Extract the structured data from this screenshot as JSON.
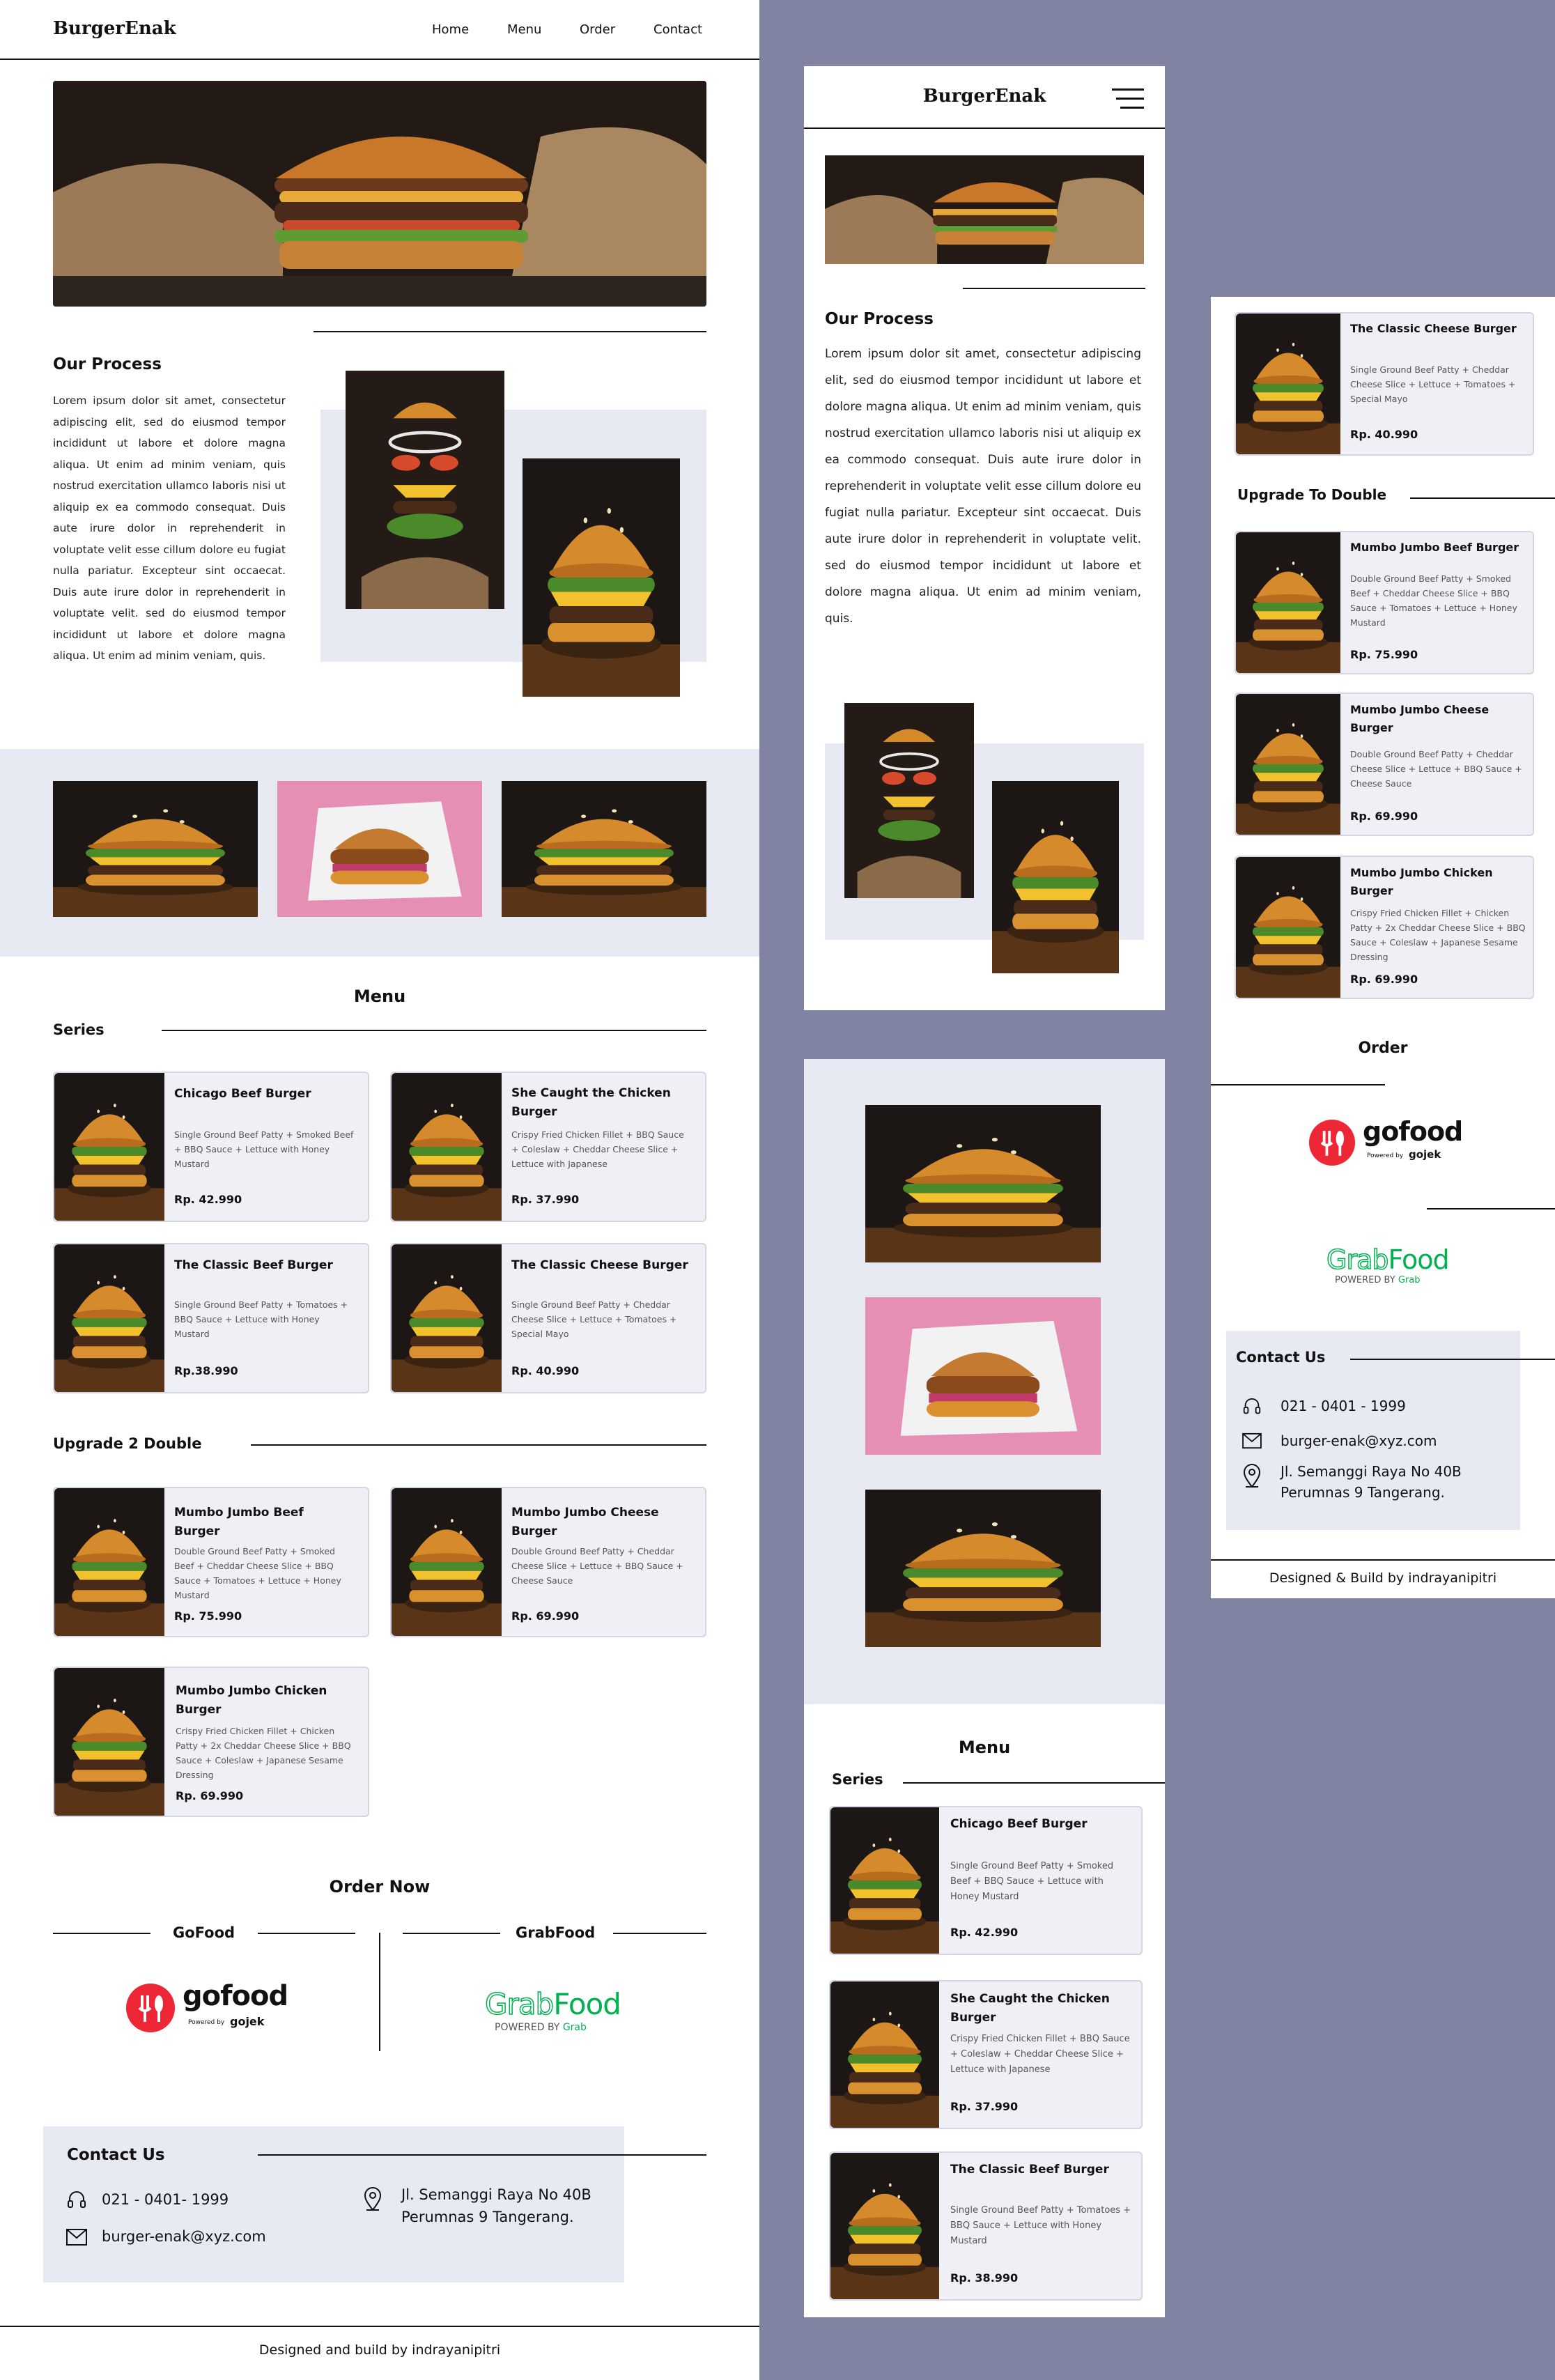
{
  "brand": "BurgerEnak",
  "nav": {
    "home": "Home",
    "menu": "Menu",
    "order": "Order",
    "contact": "Contact"
  },
  "process": {
    "title": "Our Process",
    "text": "Lorem ipsum dolor sit amet, consectetur adipiscing elit, sed do eiusmod tempor incididunt ut labore et dolore magna aliqua. Ut enim ad minim veniam, quis nostrud exercitation ullamco laboris nisi ut aliquip ex ea commodo consequat. Duis aute irure dolor in reprehenderit in voluptate velit esse cillum dolore eu fugiat nulla pariatur. Excepteur sint occaecat. Duis aute irure dolor in reprehenderit in voluptate velit. sed do eiusmod tempor incididunt ut labore et dolore magna aliqua. Ut enim ad minim veniam, quis."
  },
  "menu": {
    "title": "Menu",
    "series_label": "Series",
    "upgrade_label": "Upgrade 2 Double",
    "upgrade_label_mobile": "Upgrade To Double",
    "series": [
      {
        "name": "Chicago Beef Burger",
        "desc": "Single Ground Beef Patty + Smoked Beef + BBQ Sauce + Lettuce with Honey Mustard",
        "price": "Rp. 42.990"
      },
      {
        "name": "She Caught the Chicken Burger",
        "desc": "Crispy Fried Chicken Fillet + BBQ Sauce + Coleslaw + Cheddar Cheese Slice + Lettuce with Japanese",
        "price": "Rp. 37.990"
      },
      {
        "name": "The Classic Beef Burger",
        "desc": "Single Ground Beef Patty + Tomatoes + BBQ Sauce + Lettuce with Honey Mustard",
        "price": "Rp.38.990"
      },
      {
        "name": "The Classic Cheese Burger",
        "desc": "Single Ground Beef Patty + Cheddar Cheese Slice + Lettuce + Tomatoes + Special Mayo",
        "price": "Rp. 40.990"
      }
    ],
    "series_mobile_price_classic": "Rp. 38.990",
    "double": [
      {
        "name": "Mumbo Jumbo Beef Burger",
        "desc": "Double Ground Beef Patty + Smoked Beef + Cheddar Cheese Slice + BBQ Sauce + Tomatoes + Lettuce + Honey Mustard",
        "price": "Rp. 75.990"
      },
      {
        "name": "Mumbo Jumbo Cheese Burger",
        "desc": "Double Ground Beef Patty + Cheddar Cheese Slice + Lettuce + BBQ Sauce + Cheese Sauce",
        "price": "Rp. 69.990"
      },
      {
        "name": "Mumbo Jumbo Chicken Burger",
        "desc": "Crispy Fried Chicken Fillet + Chicken Patty + 2x Cheddar Cheese Slice + BBQ Sauce + Coleslaw + Japanese Sesame Dressing",
        "price": "Rp. 69.990"
      }
    ]
  },
  "order": {
    "title": "Order Now",
    "title_mobile": "Order",
    "gofood_label": "GoFood",
    "grabfood_label": "GrabFood",
    "gofood_logo": "gofood",
    "gofood_powered": "Powered by",
    "gojek": "gojek",
    "grab_logo_a": "Grab",
    "grab_logo_b": "Food",
    "grab_powered": "POWERED BY",
    "grab_powered_brand": "Grab"
  },
  "contact": {
    "title": "Contact Us",
    "phone": "021 - 0401- 1999",
    "phone_mobile": "021 - 0401 - 1999",
    "email": "burger-enak@xyz.com",
    "address1": "Jl. Semanggi Raya No 40B",
    "address2": "Perumnas 9 Tangerang."
  },
  "footer": {
    "desktop": "Designed and build by indrayanipitri",
    "mobile": "Designed & Build by indrayanipitri"
  },
  "colors": {
    "page_bg": "#8083a1",
    "band": "#e8eaf3",
    "card": "#eef0f6",
    "gofood_red": "#ee2737",
    "grab_green": "#00b14f"
  }
}
